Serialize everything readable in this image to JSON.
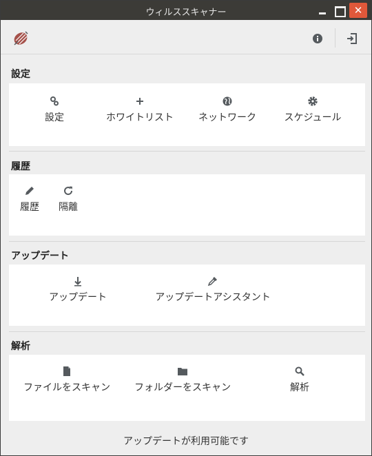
{
  "window": {
    "title": "ウィルススキャナー",
    "minimize_label": "",
    "close_label": "✕"
  },
  "colors": {
    "titlebar": "#3c3b37",
    "close_button": "#e0583a",
    "icon": "#555a5e",
    "panel": "#ffffff",
    "background": "#eeeeee"
  },
  "header": {
    "logo_icon": "virus-scanner-logo-icon",
    "info_icon": "info-circle-icon",
    "exit_icon": "sign-out-icon"
  },
  "sections": {
    "settings": {
      "title": "設定",
      "items": [
        {
          "label": "設定",
          "icon": "cogs-icon"
        },
        {
          "label": "ホワイトリスト",
          "icon": "plus-icon"
        },
        {
          "label": "ネットワーク",
          "icon": "globe-icon"
        },
        {
          "label": "スケジュール",
          "icon": "gear-icon"
        }
      ]
    },
    "history": {
      "title": "履歴",
      "items": [
        {
          "label": "履歴",
          "icon": "pencil-icon"
        },
        {
          "label": "隔離",
          "icon": "refresh-icon"
        }
      ]
    },
    "update": {
      "title": "アップデート",
      "items": [
        {
          "label": "アップデート",
          "icon": "arrow-down-icon"
        },
        {
          "label": "アップデートアシスタント",
          "icon": "eyedropper-icon"
        }
      ]
    },
    "analysis": {
      "title": "解析",
      "items": [
        {
          "label": "ファイルをスキャン",
          "icon": "file-icon"
        },
        {
          "label": "フォルダーをスキャン",
          "icon": "folder-icon"
        },
        {
          "label": "解析",
          "icon": "search-icon"
        }
      ]
    }
  },
  "status": {
    "text": "アップデートが利用可能です"
  }
}
